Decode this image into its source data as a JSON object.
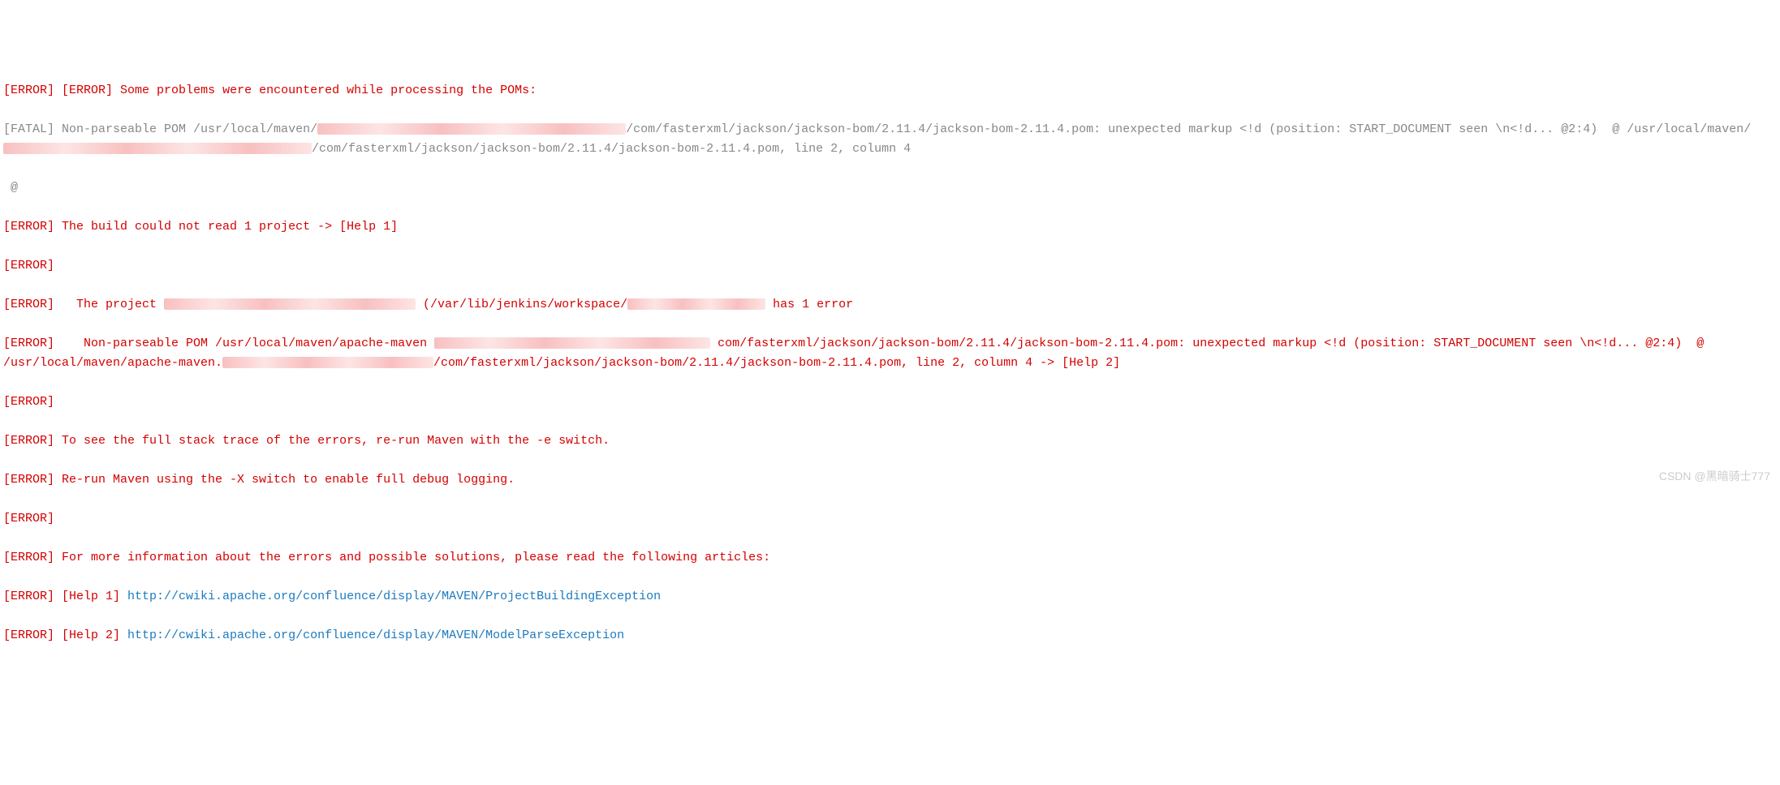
{
  "tags": {
    "error": "[ERROR]",
    "fatal": "[FATAL]"
  },
  "lines": {
    "l1_text": " Some problems were encountered while processing the POMs:",
    "l2_a": " Non-parseable POM /usr/local/maven/",
    "l2_b": "/com/fasterxml/jackson/jackson-bom/2.11.4/jackson-bom-2.11.4.pom: unexpected markup <!d (position: START_DOCUMENT seen \\n<!d... @2:4)  @ /usr/local/maven/",
    "l2_c": "/com/fasterxml/jackson/jackson-bom/2.11.4/jackson-bom-2.11.4.pom, line 2, column 4",
    "l3": " @ ",
    "l4": " The build could not read 1 project -> [Help 1]",
    "l6_a": "   The project ",
    "l6_b": " (/var/lib/jenkins/workspace/",
    "l6_c": " has 1 error",
    "l7_a": "    Non-parseable POM /usr/local/maven/apache-maven ",
    "l7_b": " com/fasterxml/jackson/jackson-bom/2.11.4/jackson-bom-2.11.4.pom: unexpected markup <!d (position: START_DOCUMENT seen \\n<!d... @2:4)  @ /usr/local/maven/apache-maven.",
    "l7_c": "/com/fasterxml/jackson/jackson-bom/2.11.4/jackson-bom-2.11.4.pom, line 2, column 4 -> [Help 2]",
    "l9": " To see the full stack trace of the errors, re-run Maven with the -e switch.",
    "l10": " Re-run Maven using the -X switch to enable full debug logging.",
    "l12": " For more information about the errors and possible solutions, please read the following articles:",
    "l13_label": " [Help 1] ",
    "l13_url": "http://cwiki.apache.org/confluence/display/MAVEN/ProjectBuildingException",
    "l14_label": " [Help 2] ",
    "l14_url": "http://cwiki.apache.org/confluence/display/MAVEN/ModelParseException"
  },
  "watermark": "CSDN @黑暗骑士777"
}
